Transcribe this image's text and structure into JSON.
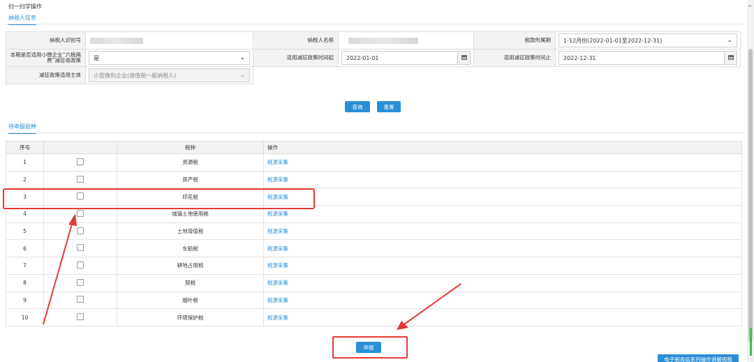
{
  "header": {
    "scan_label": "扫一扫学操作",
    "taxpayer_tab": "纳税人信息"
  },
  "form": {
    "taxpayer_id_label": "纳税人识别号",
    "taxpayer_name_label": "纳税人名称",
    "tax_period_label": "税款所属期",
    "tax_period_value": "1-12月份(2022-01-01至2022-12-31)",
    "small_micro_label": "本期是否适用小微企业“六税两费”减征收政策",
    "small_micro_value": "是",
    "policy_start_label": "适用减征政策时间起",
    "policy_start_value": "2022-01-01",
    "policy_end_label": "适用减征政策时间止",
    "policy_end_value": "2022-12-31",
    "subject_label": "减征政策适用主体",
    "subject_value": "小型微利企业(增值税一般纳税人)"
  },
  "actions": {
    "query": "查询",
    "reset": "重置",
    "submit": "申报",
    "video": "电子税务局系列操作讲解视频"
  },
  "pending": {
    "tab": "待申报税种",
    "columns": [
      "序号",
      "",
      "税种",
      "操作"
    ],
    "rows": [
      {
        "no": "1",
        "tax": "资源税",
        "op": "税源采集"
      },
      {
        "no": "2",
        "tax": "房产税",
        "op": "税源采集"
      },
      {
        "no": "3",
        "tax": "印花税",
        "op": "税源采集"
      },
      {
        "no": "4",
        "tax": "城镇土地使用税",
        "op": "税源采集"
      },
      {
        "no": "5",
        "tax": "土地增值税",
        "op": "税源采集"
      },
      {
        "no": "6",
        "tax": "车船税",
        "op": "税源采集"
      },
      {
        "no": "7",
        "tax": "耕地占用税",
        "op": "税源采集"
      },
      {
        "no": "8",
        "tax": "契税",
        "op": "税源采集"
      },
      {
        "no": "9",
        "tax": "烟叶税",
        "op": "税源采集"
      },
      {
        "no": "10",
        "tax": "环境保护税",
        "op": "税源采集"
      }
    ]
  },
  "colors": {
    "accent": "#2b8ed6",
    "annotation": "#e53935"
  }
}
